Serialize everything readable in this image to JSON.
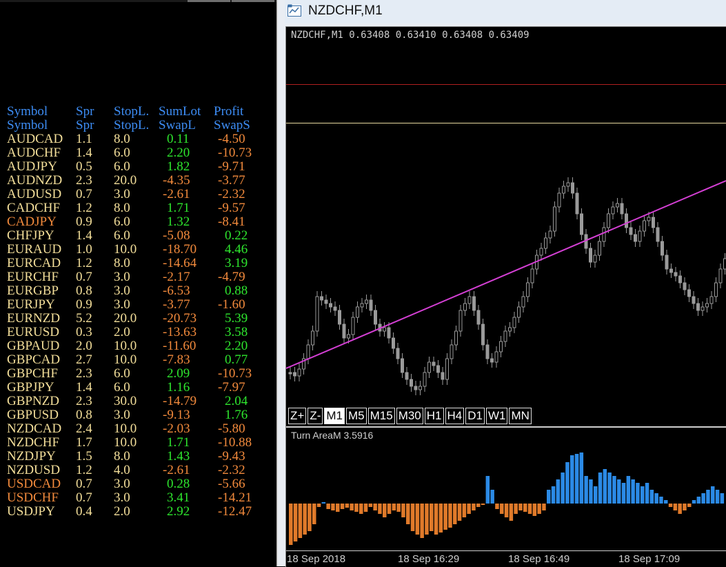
{
  "window": {
    "title": "NZDCHF,M1"
  },
  "chart": {
    "ohlc_readout": "NZDCHF,M1  0.63408 0.63410 0.63408 0.63409",
    "indicator_label": "Turn AreaM 3.5916",
    "timeframes": [
      "Z+",
      "Z-",
      "M1",
      "M5",
      "M15",
      "M30",
      "H1",
      "H4",
      "D1",
      "W1",
      "MN"
    ],
    "active_timeframe": "M1",
    "x_ticks": [
      "18 Sep 2018",
      "18 Sep 16:29",
      "18 Sep 16:49",
      "18 Sep 17:09"
    ],
    "colors": {
      "up_candle": "#9a9a9a",
      "trendline": "#d43fd4",
      "ind_pos": "#2b8ae6",
      "ind_neg": "#e07a2a"
    }
  },
  "table": {
    "header1": [
      "Symbol",
      "Spr",
      "StopL.",
      "SumLot",
      "Profit"
    ],
    "header2": [
      "Symbol",
      "Spr",
      "StopL.",
      "SwapL",
      "SwapS"
    ],
    "rows": [
      {
        "sym": "AUDCAD",
        "spr": "1.1",
        "stop": "8.0",
        "lot": "0.11",
        "pro": "-4.50",
        "sc": "y",
        "lc": "g",
        "pc": "o"
      },
      {
        "sym": "AUDCHF",
        "spr": "1.4",
        "stop": "6.0",
        "lot": "2.20",
        "pro": "-10.73",
        "sc": "y",
        "lc": "g",
        "pc": "o"
      },
      {
        "sym": "AUDJPY",
        "spr": "0.5",
        "stop": "6.0",
        "lot": "1.82",
        "pro": "-9.71",
        "sc": "y",
        "lc": "g",
        "pc": "o"
      },
      {
        "sym": "AUDNZD",
        "spr": "2.3",
        "stop": "20.0",
        "lot": "-4.35",
        "pro": "-3.77",
        "sc": "y",
        "lc": "o",
        "pc": "o"
      },
      {
        "sym": "AUDUSD",
        "spr": "0.7",
        "stop": "3.0",
        "lot": "-2.61",
        "pro": "-2.32",
        "sc": "y",
        "lc": "o",
        "pc": "o"
      },
      {
        "sym": "CADCHF",
        "spr": "1.2",
        "stop": "8.0",
        "lot": "1.71",
        "pro": "-9.57",
        "sc": "y",
        "lc": "g",
        "pc": "o"
      },
      {
        "sym": "CADJPY",
        "spr": "0.9",
        "stop": "6.0",
        "lot": "1.32",
        "pro": "-8.41",
        "sc": "o",
        "lc": "g",
        "pc": "o"
      },
      {
        "sym": "CHFJPY",
        "spr": "1.4",
        "stop": "6.0",
        "lot": "-5.08",
        "pro": "0.22",
        "sc": "y",
        "lc": "o",
        "pc": "g"
      },
      {
        "sym": "EURAUD",
        "spr": "1.0",
        "stop": "10.0",
        "lot": "-18.70",
        "pro": "4.46",
        "sc": "y",
        "lc": "o",
        "pc": "g"
      },
      {
        "sym": "EURCAD",
        "spr": "1.2",
        "stop": "8.0",
        "lot": "-14.64",
        "pro": "3.19",
        "sc": "y",
        "lc": "o",
        "pc": "g"
      },
      {
        "sym": "EURCHF",
        "spr": "0.7",
        "stop": "3.0",
        "lot": "-2.17",
        "pro": "-4.79",
        "sc": "y",
        "lc": "o",
        "pc": "o"
      },
      {
        "sym": "EURGBP",
        "spr": "0.8",
        "stop": "3.0",
        "lot": "-6.53",
        "pro": "0.88",
        "sc": "y",
        "lc": "o",
        "pc": "g"
      },
      {
        "sym": "EURJPY",
        "spr": "0.9",
        "stop": "3.0",
        "lot": "-3.77",
        "pro": "-1.60",
        "sc": "y",
        "lc": "o",
        "pc": "o"
      },
      {
        "sym": "EURNZD",
        "spr": "5.2",
        "stop": "20.0",
        "lot": "-20.73",
        "pro": "5.39",
        "sc": "y",
        "lc": "o",
        "pc": "g"
      },
      {
        "sym": "EURUSD",
        "spr": "0.3",
        "stop": "2.0",
        "lot": "-13.63",
        "pro": "3.58",
        "sc": "y",
        "lc": "o",
        "pc": "g"
      },
      {
        "sym": "GBPAUD",
        "spr": "2.0",
        "stop": "10.0",
        "lot": "-11.60",
        "pro": "2.20",
        "sc": "y",
        "lc": "o",
        "pc": "g"
      },
      {
        "sym": "GBPCAD",
        "spr": "2.7",
        "stop": "10.0",
        "lot": "-7.83",
        "pro": "0.77",
        "sc": "y",
        "lc": "o",
        "pc": "g"
      },
      {
        "sym": "GBPCHF",
        "spr": "2.3",
        "stop": "6.0",
        "lot": "2.09",
        "pro": "-10.73",
        "sc": "y",
        "lc": "g",
        "pc": "o"
      },
      {
        "sym": "GBPJPY",
        "spr": "1.4",
        "stop": "6.0",
        "lot": "1.16",
        "pro": "-7.97",
        "sc": "y",
        "lc": "g",
        "pc": "o"
      },
      {
        "sym": "GBPNZD",
        "spr": "2.3",
        "stop": "30.0",
        "lot": "-14.79",
        "pro": "2.04",
        "sc": "y",
        "lc": "o",
        "pc": "g"
      },
      {
        "sym": "GBPUSD",
        "spr": "0.8",
        "stop": "3.0",
        "lot": "-9.13",
        "pro": "1.76",
        "sc": "y",
        "lc": "o",
        "pc": "g"
      },
      {
        "sym": "NZDCAD",
        "spr": "2.4",
        "stop": "10.0",
        "lot": "-2.03",
        "pro": "-5.80",
        "sc": "y",
        "lc": "o",
        "pc": "o"
      },
      {
        "sym": "NZDCHF",
        "spr": "1.7",
        "stop": "10.0",
        "lot": "1.71",
        "pro": "-10.88",
        "sc": "y",
        "lc": "g",
        "pc": "o"
      },
      {
        "sym": "NZDJPY",
        "spr": "1.5",
        "stop": "8.0",
        "lot": "1.43",
        "pro": "-9.43",
        "sc": "y",
        "lc": "g",
        "pc": "o"
      },
      {
        "sym": "NZDUSD",
        "spr": "1.2",
        "stop": "4.0",
        "lot": "-2.61",
        "pro": "-2.32",
        "sc": "y",
        "lc": "o",
        "pc": "o"
      },
      {
        "sym": "USDCAD",
        "spr": "0.7",
        "stop": "3.0",
        "lot": "0.28",
        "pro": "-5.66",
        "sc": "o",
        "lc": "g",
        "pc": "o"
      },
      {
        "sym": "USDCHF",
        "spr": "0.7",
        "stop": "3.0",
        "lot": "3.41",
        "pro": "-14.21",
        "sc": "o",
        "lc": "g",
        "pc": "o"
      },
      {
        "sym": "USDJPY",
        "spr": "0.4",
        "stop": "2.0",
        "lot": "2.92",
        "pro": "-12.47",
        "sc": "y",
        "lc": "g",
        "pc": "o"
      }
    ]
  }
}
